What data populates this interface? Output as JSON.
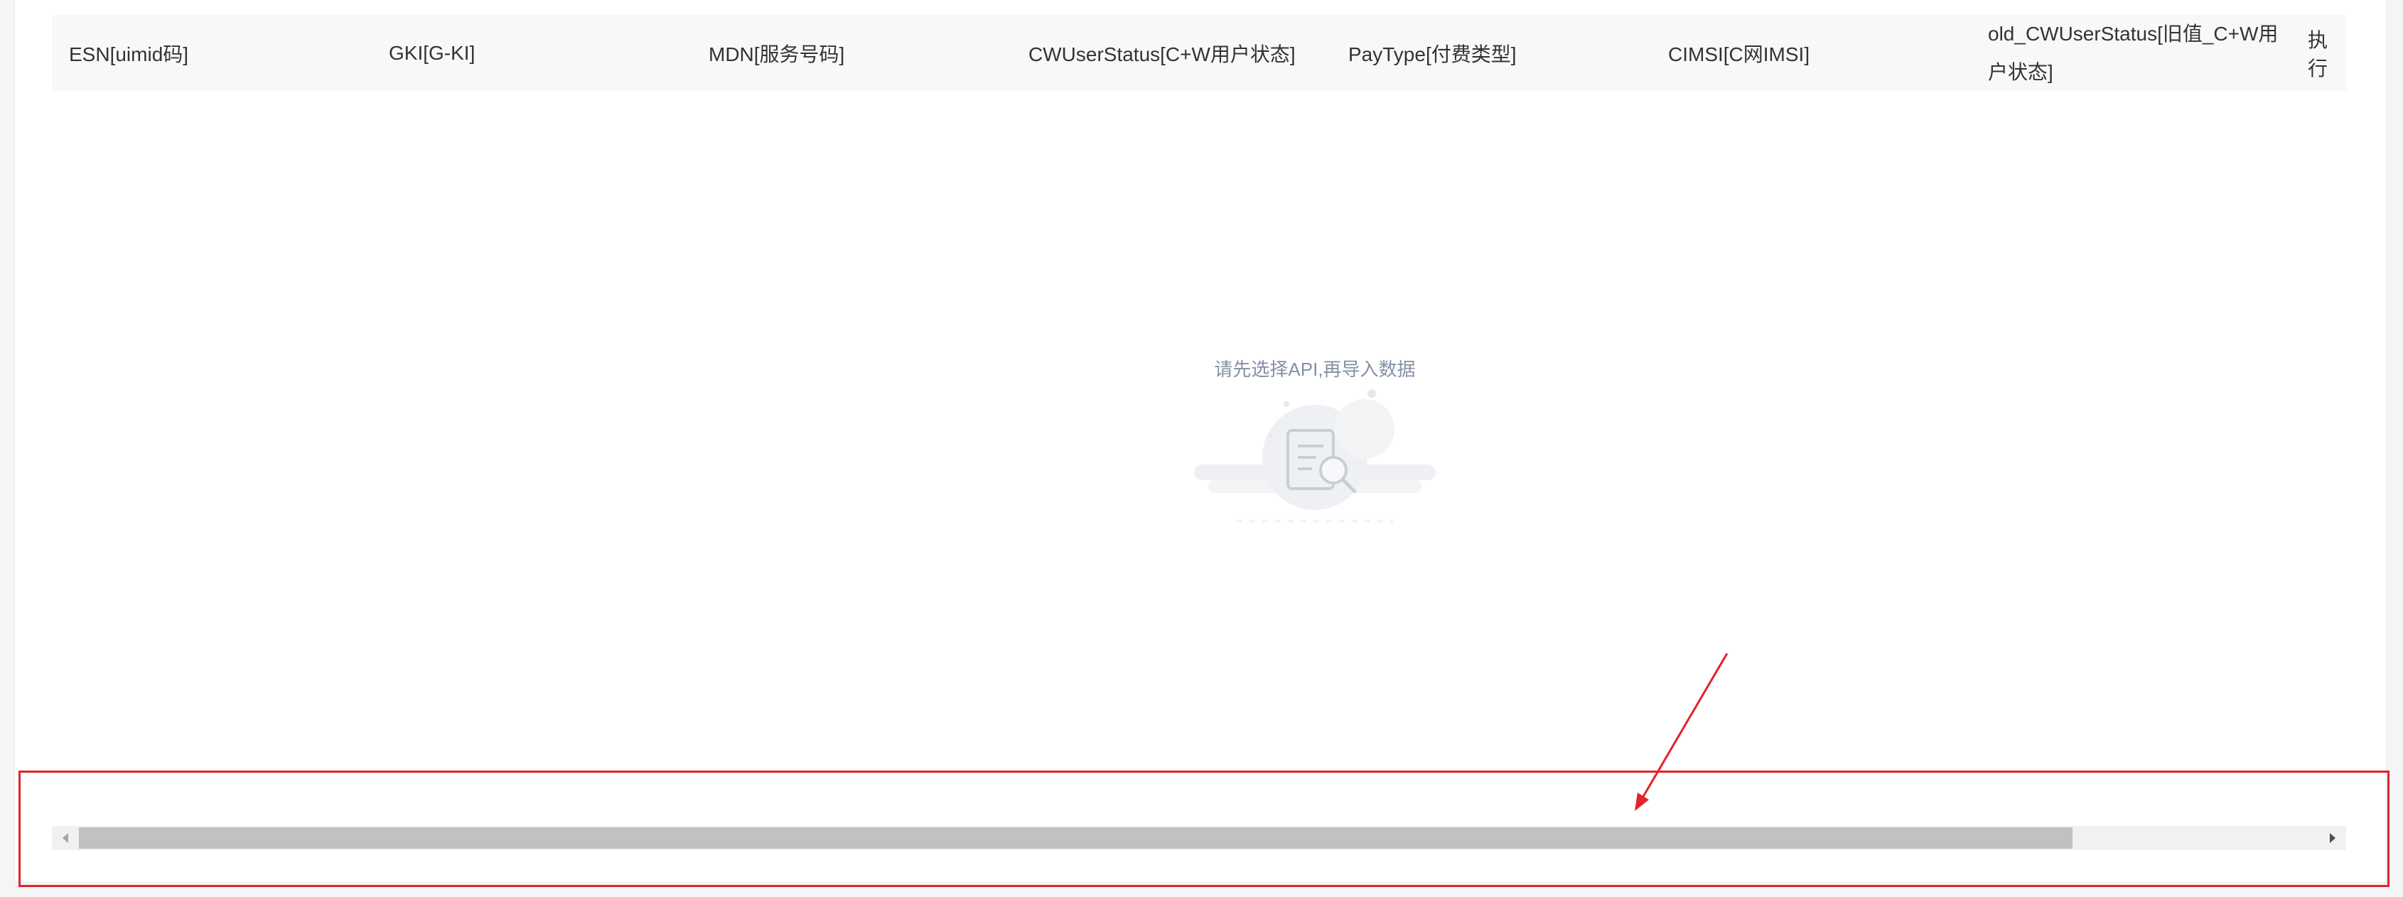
{
  "table": {
    "columns": [
      "ESN[uimid码]",
      "GKI[G-KI]",
      "MDN[服务号码]",
      "CWUserStatus[C+W用户状态]",
      "PayType[付费类型]",
      "CIMSI[C网IMSI]",
      "old_CWUserStatus[旧值_C+W用户状态]",
      "执行"
    ],
    "column_lines": {
      "col6_line1": "old_CWUserStatus[旧值_C+W用",
      "col6_line2": "户状态]"
    }
  },
  "empty_state": {
    "message": "请先选择API,再导入数据",
    "icon": "empty-document-search-icon"
  },
  "scrollbar": {
    "left_icon": "scroll-left-icon",
    "right_icon": "scroll-right-icon",
    "thumb_fraction": 0.89
  },
  "colors": {
    "highlight": "#e3222b",
    "header_bg": "#f7f8fa",
    "empty_text": "#8590a6"
  }
}
